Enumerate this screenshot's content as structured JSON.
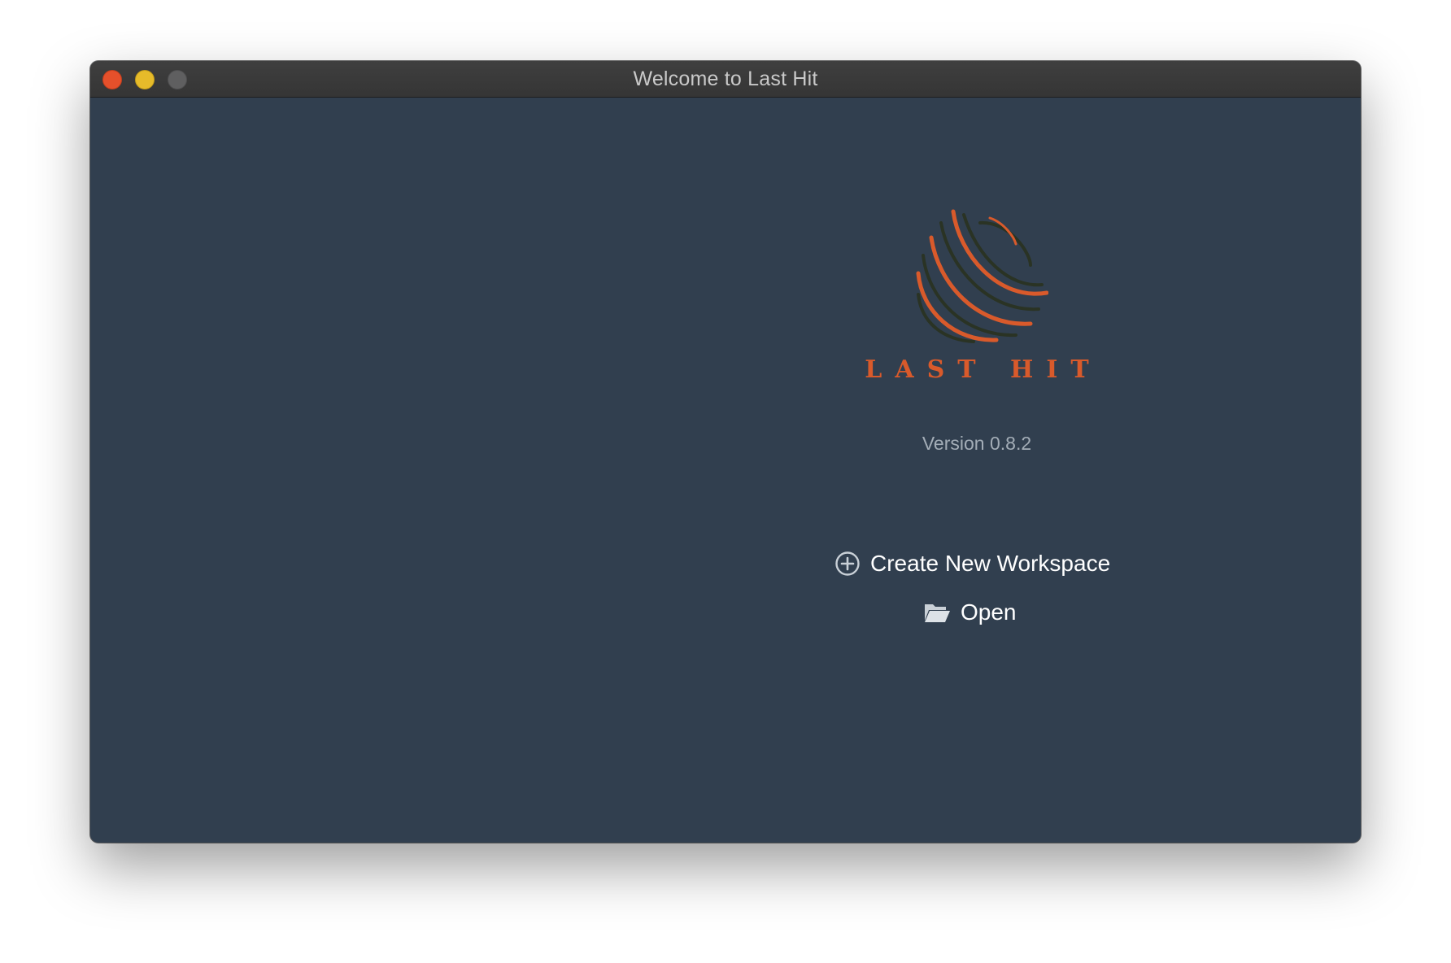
{
  "window": {
    "title": "Welcome to Last Hit"
  },
  "brand": {
    "logo_icon": "striped-globe-icon",
    "wordmark": "LAST HIT",
    "accent_color": "#d95a2b",
    "dark_stripe_color": "#2a3324"
  },
  "version": {
    "label": "Version 0.8.2"
  },
  "actions": {
    "create": {
      "label": "Create New Workspace",
      "icon": "plus-circle-icon"
    },
    "open": {
      "label": "Open",
      "icon": "folder-open-icon"
    }
  },
  "colors": {
    "window_background": "#313f4f",
    "titlebar": "#3a3a3a",
    "close": "#e5502b",
    "minimize": "#e6bb2a",
    "zoom": "#5f5f60"
  }
}
